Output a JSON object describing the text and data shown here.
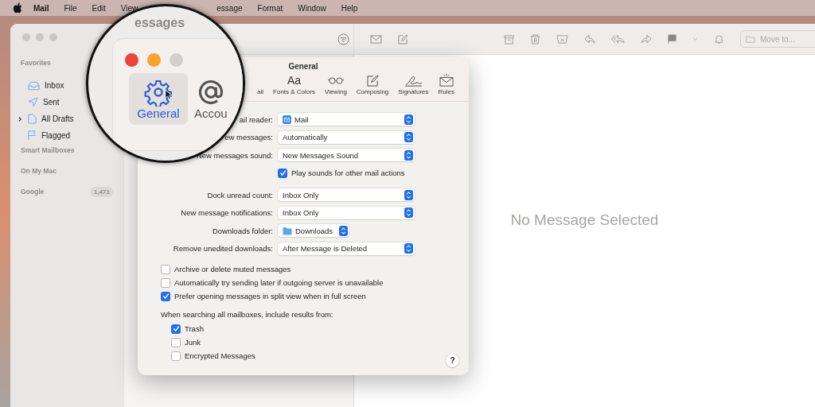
{
  "menu_bar": {
    "app_name": "Mail",
    "items": [
      "File",
      "Edit",
      "View",
      "essage",
      "Format",
      "Window",
      "Help"
    ]
  },
  "window_title": "essages",
  "sidebar": {
    "sections": [
      {
        "title": "Favorites",
        "items": [
          {
            "label": "Inbox",
            "expandable": false
          },
          {
            "label": "Sent",
            "expandable": false
          },
          {
            "label": "All Drafts",
            "expandable": true
          },
          {
            "label": "Flagged",
            "expandable": false
          }
        ]
      },
      {
        "title": "Smart Mailboxes"
      },
      {
        "title": "On My Mac"
      },
      {
        "title": "Google",
        "badge": "1,471"
      }
    ]
  },
  "toolbar": {
    "move_to": {
      "placeholder": "Move to..."
    }
  },
  "message_pane": {
    "empty_text": "No Message Selected"
  },
  "dialog": {
    "title": "General",
    "tabs": [
      {
        "label": "General",
        "selected": true
      },
      {
        "label": "Accou",
        "selected": false
      },
      {
        "label": "ail",
        "selected": false
      },
      {
        "label": "Fonts & Colors",
        "glyph": "Aa",
        "selected": false
      },
      {
        "label": "Viewing",
        "selected": false
      },
      {
        "label": "Composing",
        "selected": false
      },
      {
        "label": "Signatures",
        "selected": false
      },
      {
        "label": "Rules",
        "selected": false
      }
    ],
    "rows": [
      {
        "kind": "app-popup",
        "label": "ail reader:",
        "value": "Mail"
      },
      {
        "kind": "popup",
        "label": "ew messages:",
        "value": "Automatically"
      },
      {
        "kind": "popup",
        "label": "New messages sound:",
        "value": "New Messages Sound"
      },
      {
        "kind": "check",
        "label": "Play sounds for other mail actions",
        "checked": true
      },
      {
        "kind": "gap"
      },
      {
        "kind": "popup",
        "label": "Dock unread count:",
        "value": "Inbox Only"
      },
      {
        "kind": "popup",
        "label": "New message notifications:",
        "value": "Inbox Only"
      },
      {
        "kind": "folder-popup",
        "label": "Downloads folder:",
        "value": "Downloads"
      },
      {
        "kind": "popup",
        "label": "Remove unedited downloads:",
        "value": "After Message is Deleted"
      }
    ],
    "options": [
      {
        "label": "Archive or delete muted messages",
        "checked": false
      },
      {
        "label": "Automatically try sending later if outgoing server is unavailable",
        "checked": false
      },
      {
        "label": "Prefer opening messages in split view when in full screen",
        "checked": true
      }
    ],
    "search_heading": "When searching all mailboxes, include results from:",
    "search_options": [
      {
        "label": "Trash",
        "checked": true
      },
      {
        "label": "Junk",
        "checked": false
      },
      {
        "label": "Encrypted Messages",
        "checked": false
      }
    ],
    "help": "?"
  }
}
